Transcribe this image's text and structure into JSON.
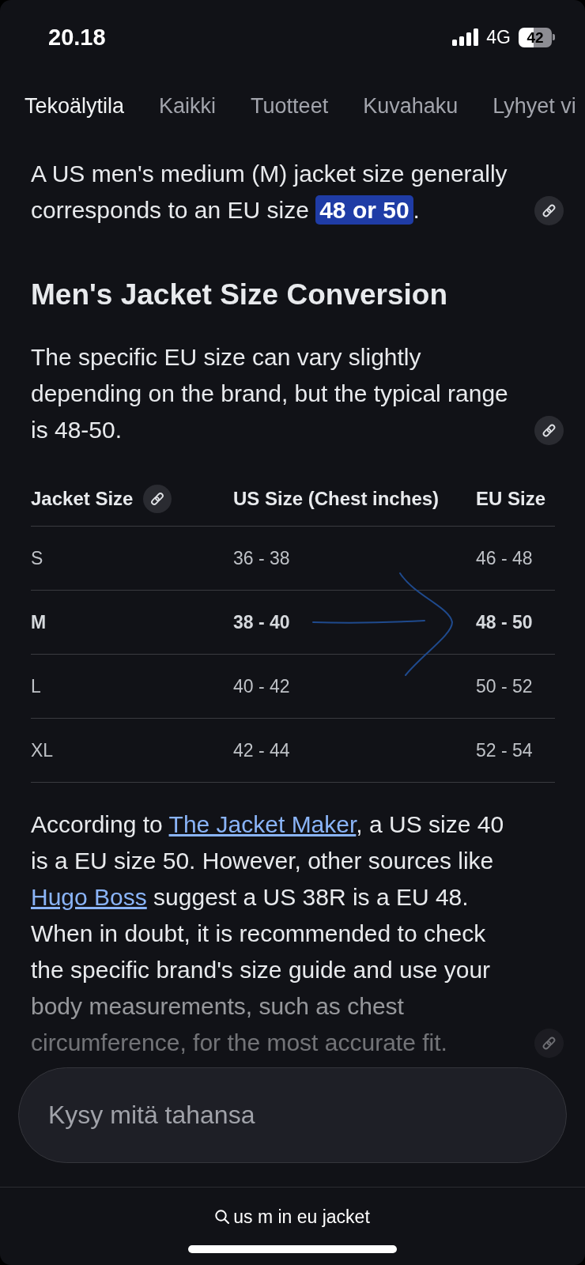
{
  "status_bar": {
    "time": "20.18",
    "network": "4G",
    "battery": "42"
  },
  "tabs": [
    {
      "label": "Tekoälytila",
      "selected": true
    },
    {
      "label": "Kaikki",
      "selected": false
    },
    {
      "label": "Tuotteet",
      "selected": false
    },
    {
      "label": "Kuvahaku",
      "selected": false
    },
    {
      "label": "Lyhyet vi",
      "selected": false
    }
  ],
  "content": [
    {
      "kind": "paragraph",
      "parts": [
        {
          "kind": "text",
          "text": "A US men's medium (M) jacket size generally corresponds to an EU size "
        },
        {
          "kind": "highlight",
          "text": "48 or 50"
        },
        {
          "kind": "text",
          "text": "."
        }
      ],
      "source_link": true,
      "faded": false
    },
    {
      "kind": "heading",
      "text": "Men's Jacket Size Conversion"
    },
    {
      "kind": "paragraph",
      "parts": [
        {
          "kind": "text",
          "text": "The specific EU size can vary slightly depending on the brand, but the typical range is 48-50."
        }
      ],
      "source_link": true,
      "faded": false
    },
    {
      "kind": "table",
      "columns": [
        {
          "label": "Jacket Size",
          "source_link": true
        },
        {
          "label": "US Size (Chest inches)",
          "source_link": false
        },
        {
          "label": "EU Size",
          "source_link": false
        }
      ],
      "rows": [
        {
          "cells": [
            "S",
            "36 - 38",
            "46 - 48"
          ],
          "emphasized": false,
          "arrow_annotation": false
        },
        {
          "cells": [
            "M",
            "38 - 40",
            "48 - 50"
          ],
          "emphasized": true,
          "arrow_annotation": true
        },
        {
          "cells": [
            "L",
            "40 - 42",
            "50 - 52"
          ],
          "emphasized": false,
          "arrow_annotation": false
        },
        {
          "cells": [
            "XL",
            "42 - 44",
            "52 - 54"
          ],
          "emphasized": false,
          "arrow_annotation": false
        }
      ]
    },
    {
      "kind": "paragraph",
      "parts": [
        {
          "kind": "text",
          "text": "According to "
        },
        {
          "kind": "link",
          "text": "The Jacket Maker"
        },
        {
          "kind": "text",
          "text": ", a US size 40 is a EU size 50. However, other sources like "
        },
        {
          "kind": "link",
          "text": "Hugo Boss"
        },
        {
          "kind": "text",
          "text": " suggest a US 38R is a EU 48. When in doubt, it is recommended to check the specific brand's size guide and use your body measurements, such as chest circumference, for the most accurate fit."
        }
      ],
      "source_link": true,
      "faded": true
    }
  ],
  "ask_field": {
    "placeholder": "Kysy mitä tahansa"
  },
  "query_bar": {
    "query": "us m in eu jacket"
  }
}
